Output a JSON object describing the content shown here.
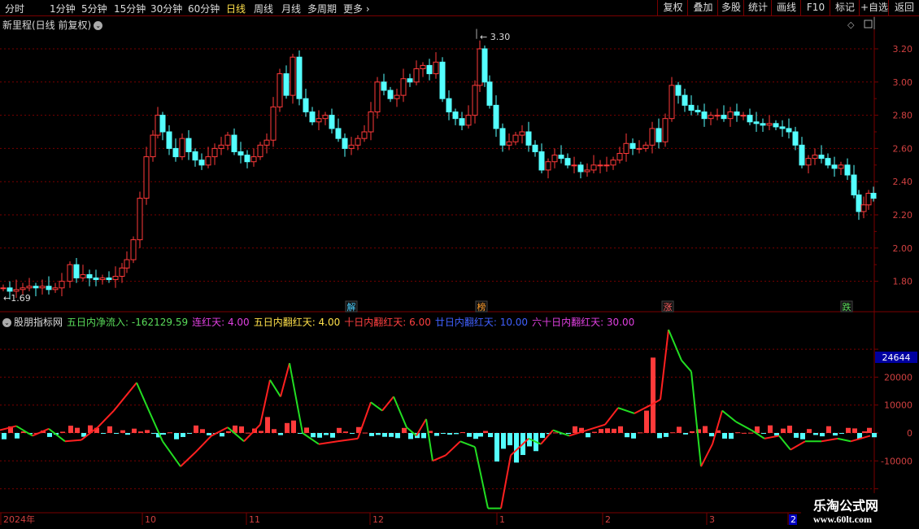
{
  "toolbar": {
    "periods": [
      "分时",
      "1分钟",
      "5分钟",
      "15分钟",
      "30分钟",
      "60分钟",
      "日线",
      "周线",
      "月线",
      "多周期",
      "更多"
    ],
    "active": "日线",
    "buttons": [
      "复权",
      "叠加",
      "多股",
      "统计",
      "画线",
      "F10",
      "标记",
      "+自选",
      "返回"
    ]
  },
  "main_title": "新里程(日线 前复权)",
  "price_axis": [
    "3.20",
    "3.00",
    "2.80",
    "2.60",
    "2.40",
    "2.20",
    "2.00",
    "1.80"
  ],
  "markers": {
    "high_label": "3.30",
    "low_label": "1.69",
    "tags": [
      {
        "text": "解",
        "color": "#4ad0ff"
      },
      {
        "text": "榜",
        "color": "#ff9c2a"
      },
      {
        "text": "涨",
        "color": "#ff6060"
      },
      {
        "text": "跌",
        "color": "#5adc5a"
      }
    ]
  },
  "indicator": {
    "name": "股朋指标网",
    "items": [
      {
        "text": "五日内净流入: -162129.59",
        "color": "#5adc5a"
      },
      {
        "text": "连红天: 4.00",
        "color": "#e040e0"
      },
      {
        "text": "五日内翻红天: 4.00",
        "color": "#ffe04a"
      },
      {
        "text": "十日内翻红天: 6.00",
        "color": "#ff4040"
      },
      {
        "text": "廿日内翻红天: 10.00",
        "color": "#4060ff"
      },
      {
        "text": "六十日内翻红天: 30.00",
        "color": "#e040e0"
      }
    ],
    "axis": [
      "20000",
      "10000",
      "0",
      "-10000"
    ],
    "highlight_value": "24644"
  },
  "date_axis": [
    "2024年",
    "10",
    "11",
    "12",
    "1",
    "2",
    "3",
    "2"
  ],
  "watermark": {
    "line1": "乐淘公式网",
    "line2": "www.60lt.com"
  },
  "colors": {
    "up": "#ff3a3a",
    "down": "#54ffff",
    "grid": "#7a0000",
    "line_green": "#22dd22",
    "line_red": "#ff2020"
  }
}
